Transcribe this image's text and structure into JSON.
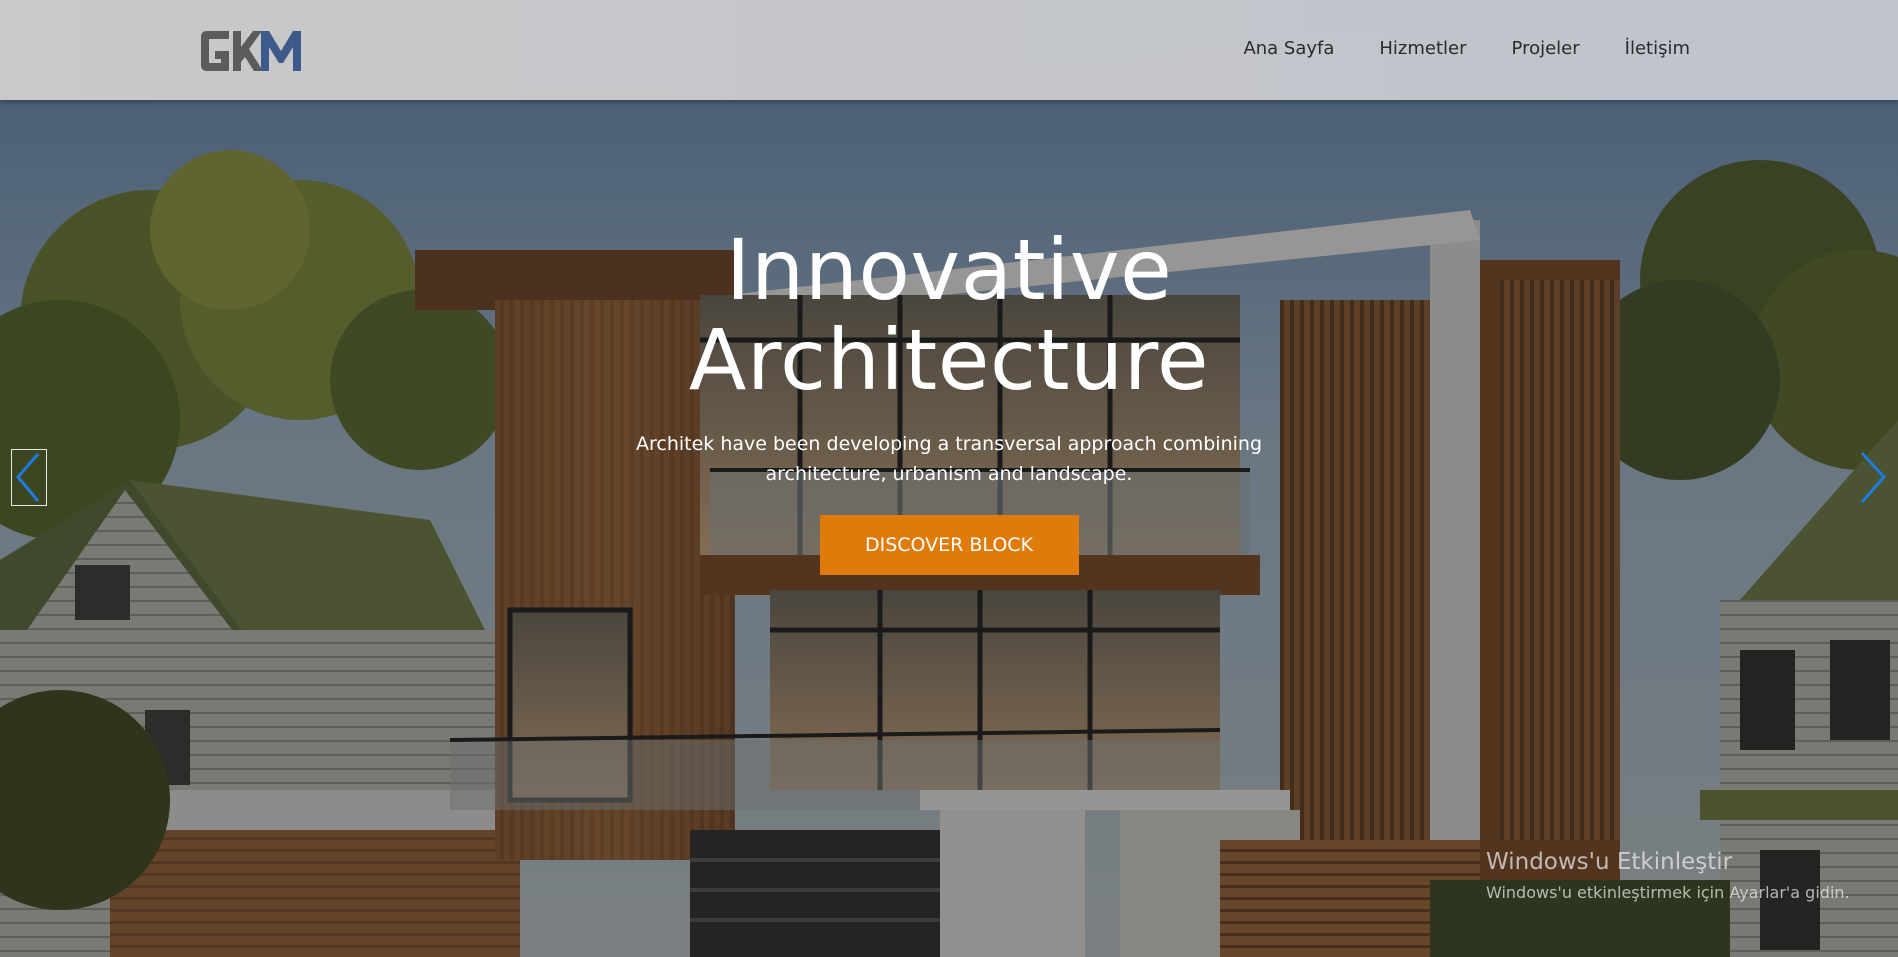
{
  "header": {
    "logo_text": "GKM",
    "nav": [
      {
        "label": "Ana Sayfa"
      },
      {
        "label": "Hizmetler"
      },
      {
        "label": "Projeler"
      },
      {
        "label": "İletişim"
      }
    ]
  },
  "hero": {
    "title_line1": "Innovative",
    "title_line2": "Architecture",
    "subtitle": "Architek have been developing a transversal approach combining architecture, urbanism and landscape.",
    "cta_label": "DISCOVER BLOCK"
  },
  "slider": {
    "prev_icon": "chevron-left-icon",
    "next_icon": "chevron-right-icon"
  },
  "watermark": {
    "title": "Windows'u Etkinleştir",
    "subtitle": "Windows'u etkinleştirmek için Ayarlar'a gidin."
  },
  "colors": {
    "accent": "#e07b0a",
    "logo_gray": "#5b5b5d",
    "logo_blue": "#3d5a8c",
    "arrow_blue": "#1e7be0"
  }
}
